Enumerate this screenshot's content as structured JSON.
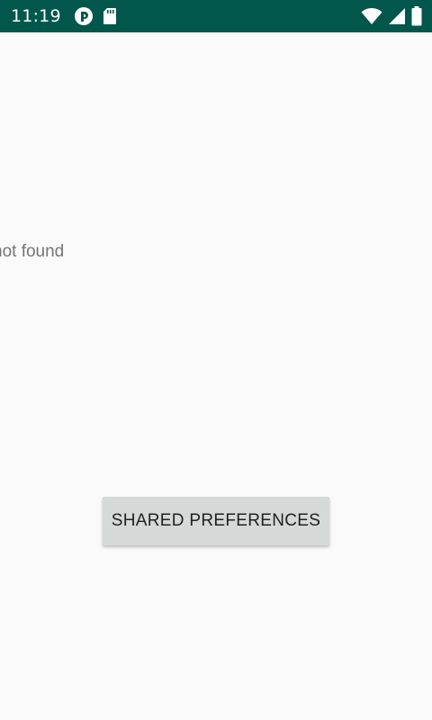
{
  "status_bar": {
    "time": "11:19",
    "left_icons": [
      "circle-badge-icon",
      "sd-card-icon"
    ],
    "right_icons": [
      "wifi-icon",
      "cell-signal-icon",
      "battery-icon"
    ],
    "background": "#01574b"
  },
  "main": {
    "message": "not found",
    "button_label": "SHARED PREFERENCES"
  }
}
